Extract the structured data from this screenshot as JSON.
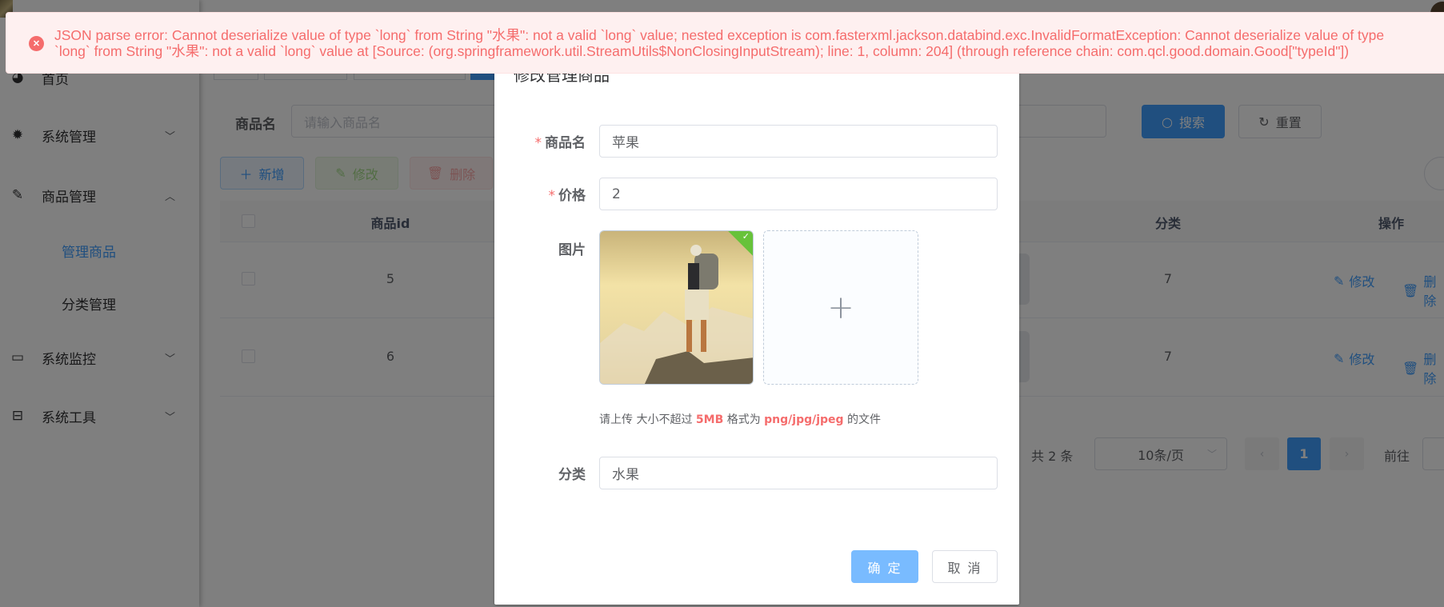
{
  "sidebar": {
    "items": [
      {
        "label": "首页",
        "icon": "dashboard-icon"
      },
      {
        "label": "系统管理",
        "icon": "gear-icon"
      },
      {
        "label": "商品管理",
        "icon": "edit-icon"
      },
      {
        "label": "系统监控",
        "icon": "monitor-icon"
      },
      {
        "label": "系统工具",
        "icon": "toolbox-icon"
      }
    ],
    "sub_items": [
      {
        "label": "管理商品",
        "active": true
      },
      {
        "label": "分类管理",
        "active": false
      }
    ]
  },
  "search": {
    "name_label": "商品名",
    "name_placeholder": "请输入商品名",
    "search_label": "搜索",
    "reset_label": "重置"
  },
  "toolbar": {
    "add_label": "新增",
    "edit_label": "修改",
    "delete_label": "删除"
  },
  "table": {
    "headers": {
      "id": "商品id",
      "category": "分类",
      "actions": "操作"
    },
    "rows": [
      {
        "id": "5",
        "category": "7",
        "edit": "修改",
        "delete": "删除"
      },
      {
        "id": "6",
        "category": "7",
        "edit": "修改",
        "delete": "删除"
      }
    ]
  },
  "pagination": {
    "total": "共 2 条",
    "page_size": "10条/页",
    "current_page": "1",
    "goto": "前往"
  },
  "dialog": {
    "title": "修改管理商品",
    "name_label": "商品名",
    "name_value": "苹果",
    "price_label": "价格",
    "price_value": "2",
    "image_label": "图片",
    "hint_prefix": "请上传 大小不超过",
    "hint_size": "5MB",
    "hint_mid": "格式为",
    "hint_types": "png/jpg/jpeg",
    "hint_suffix": "的文件",
    "category_label": "分类",
    "category_value": "水果",
    "confirm_label": "确 定",
    "cancel_label": "取 消"
  },
  "message": {
    "type": "error",
    "line1": "JSON parse error: Cannot deserialize value of type `long` from String \"水果\": not a valid `long` value; nested exception is com.fasterxml.jackson.databind.exc.InvalidFormatException: Cannot deserialize value of type",
    "line2": "`long` from String \"水果\": not a valid `long` value at [Source: (org.springframework.util.StreamUtils$NonClosingInputStream); line: 1, column: 204] (through reference chain: com.qcl.good.domain.Good[\"typeId\"])"
  },
  "colors": {
    "primary": "#409eff",
    "danger": "#f56c6c",
    "success": "#67c23a"
  }
}
